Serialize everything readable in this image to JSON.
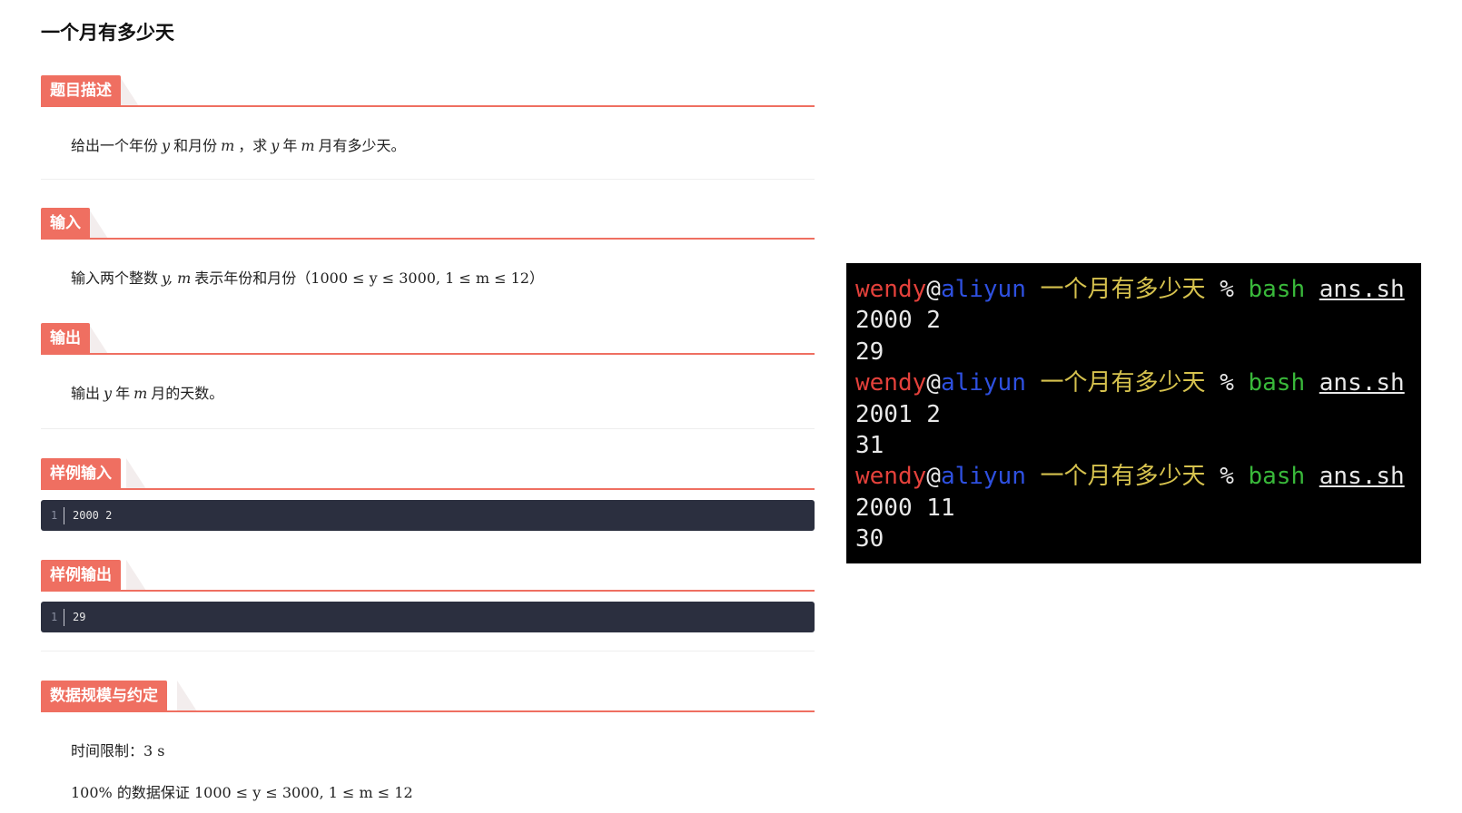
{
  "problem": {
    "title": "一个月有多少天",
    "sections": {
      "description": {
        "heading": "题目描述",
        "text_a": "给出一个年份",
        "var_y": "y",
        "text_b": "和月份",
        "var_m": "m",
        "text_c": "，求",
        "var_y2": "y",
        "text_d": "年",
        "var_m2": "m",
        "text_e": "月有多少天。"
      },
      "input": {
        "heading": "输入",
        "text_a": "输入两个整数",
        "vars": "y, m",
        "text_b": "表示年份和月份",
        "constraint": "（1000 ≤ y ≤ 3000, 1 ≤ m ≤ 12）"
      },
      "output": {
        "heading": "输出",
        "text_a": "输出",
        "var_y": "y",
        "text_b": "年",
        "var_m": "m",
        "text_c": "月的天数。"
      },
      "sample_input": {
        "heading": "样例输入",
        "line_no": "1",
        "code": "2000 2"
      },
      "sample_output": {
        "heading": "样例输出",
        "line_no": "1",
        "code": "29"
      },
      "limits": {
        "heading": "数据规模与约定",
        "time_label": "时间限制：",
        "time_value": "3 s",
        "guarantee_pct": "100%",
        "guarantee_text": "的数据保证",
        "guarantee_math": "1000 ≤ y ≤ 3000, 1 ≤ m ≤ 12"
      }
    }
  },
  "terminal": {
    "prompt": {
      "user": "wendy",
      "at": "@",
      "host": "aliyun",
      "dir": "一个月有多少天",
      "symbol": "%",
      "command": "bash",
      "argument": "ans.sh"
    },
    "runs": [
      {
        "input": "2000 2",
        "output": "29"
      },
      {
        "input": "2001 2",
        "output": "31"
      },
      {
        "input": "2000 11",
        "output": "30"
      }
    ],
    "colors": {
      "background": "#000000",
      "user": "#e4413b",
      "host": "#2e50e0",
      "dir": "#d6c24e",
      "command": "#39b83a"
    }
  },
  "theme": {
    "accent": "#ef6f61",
    "code_bg": "#2b2f3f"
  }
}
